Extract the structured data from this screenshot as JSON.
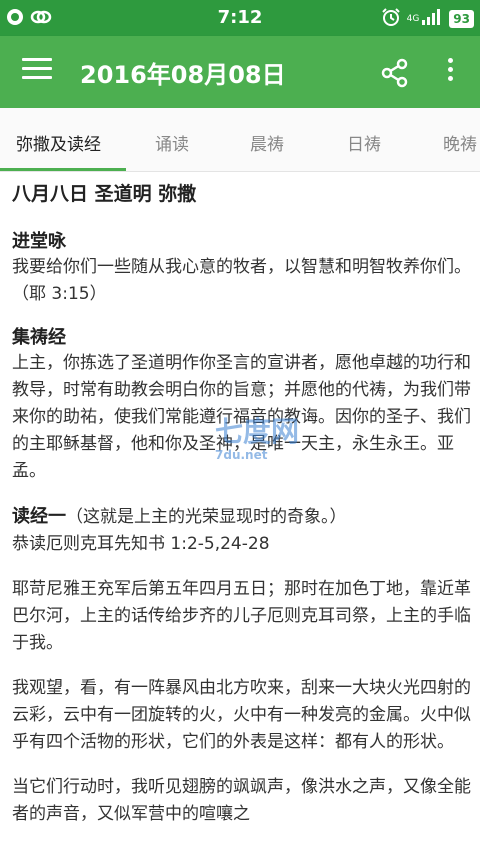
{
  "status_bar": {
    "time": "7:12",
    "battery": "93",
    "network": "4G",
    "left_icons": [
      "chat-bubble-icon",
      "link-icon"
    ],
    "right_icons": [
      "alarm-clock-icon",
      "signal-icon",
      "battery-icon"
    ]
  },
  "app_bar": {
    "title": "2016年08月08日",
    "icons": [
      "hamburger-menu-icon",
      "share-icon",
      "more-vert-icon"
    ]
  },
  "tabs": [
    {
      "label": "弥撒及读经",
      "active": true
    },
    {
      "label": "诵读",
      "active": false
    },
    {
      "label": "晨祷",
      "active": false
    },
    {
      "label": "日祷",
      "active": false
    },
    {
      "label": "晚祷",
      "active": false
    }
  ],
  "content": {
    "main_heading": "八月八日 圣道明 弥撒",
    "entrance": {
      "title": "进堂咏",
      "text": "我要给你们一些随从我心意的牧者，以智慧和明智牧养你们。（耶 3:15）"
    },
    "collect": {
      "title": "集祷经",
      "text": "上主，你拣选了圣道明作你圣言的宣讲者，愿他卓越的功行和教导，时常有助教会明白你的旨意；并愿他的代祷，为我们带来你的助祐，使我们常能遵行福音的教诲。因你的圣子、我们的主耶稣基督，他和你及圣神，是唯一天主，永生永王。亚孟。"
    },
    "reading1": {
      "title": "读经一",
      "subtitle": "（这就是上主的光荣显现时的奇象。）",
      "source": "恭读厄则克耳先知书 1:2-5,24-28"
    },
    "paragraphs": [
      "耶苛尼雅王充军后第五年四月五日；那时在加色丁地，靠近革巴尔河，上主的话传给步齐的儿子厄则克耳司祭，上主的手临于我。",
      "我观望，看，有一阵暴风由北方吹来，刮来一大块火光四射的云彩，云中有一团旋转的火，火中有一种发亮的金属。火中似乎有四个活物的形状，它们的外表是这样：都有人的形状。",
      "当它们行动时，我听见翅膀的飒飒声，像洪水之声，又像全能者的声音，又似军营中的喧嚷之"
    ]
  },
  "watermark": {
    "text": "七度网",
    "small": "7du.net"
  },
  "colors": {
    "status_bar": "#2e9a3e",
    "app_bar": "#4caf50",
    "tab_indicator": "#4caf50"
  }
}
